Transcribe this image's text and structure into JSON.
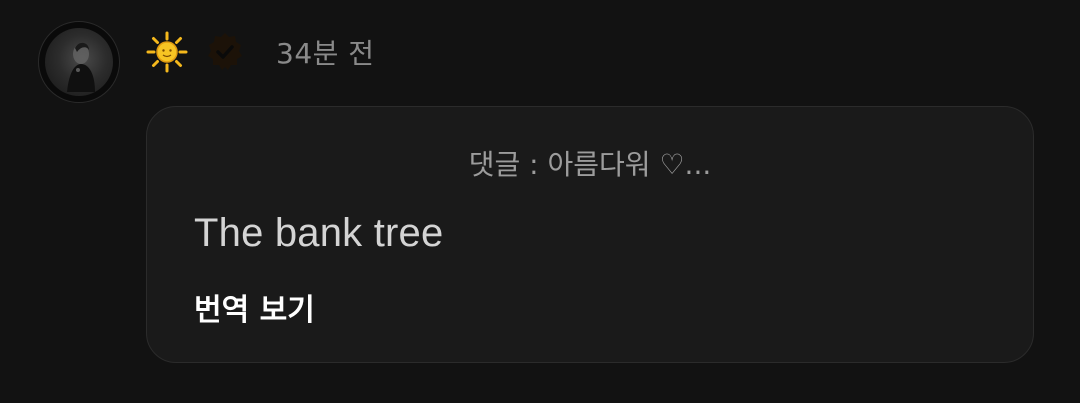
{
  "comment": {
    "time_ago": "34분 전",
    "reply_context": "댓글 : 아름다워 ♡...",
    "text": "The bank tree",
    "translate_label": "번역 보기"
  },
  "icons": {
    "sun": "sun-emoji-icon",
    "verified": "verified-badge-icon"
  },
  "colors": {
    "background": "#121212",
    "bubble": "#1a1a1a",
    "timestamp": "#8a8a8a",
    "sun": "#f5b81c"
  }
}
